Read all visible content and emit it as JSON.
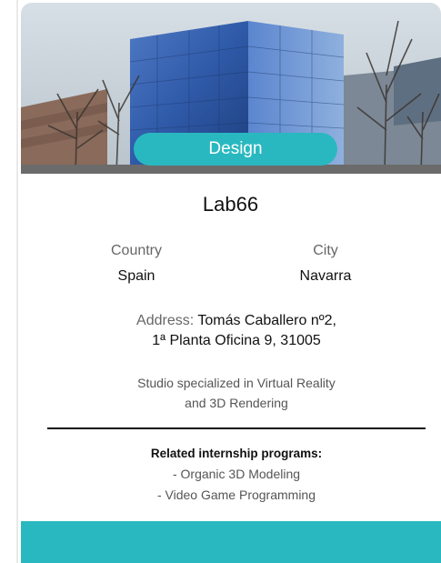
{
  "card": {
    "category": "Design",
    "title": "Lab66",
    "country_label": "Country",
    "country_value": "Spain",
    "city_label": "City",
    "city_value": "Navarra",
    "address_label": "Address:",
    "address_line1": "Tomás Caballero nº2,",
    "address_line2": "1ª Planta Oficina 9, 31005",
    "description_line1": "Studio specialized in Virtual Reality",
    "description_line2": "and 3D Rendering",
    "programs_heading": "Related internship programs:",
    "programs": [
      "- Organic 3D Modeling",
      "- Video Game Programming"
    ]
  },
  "colors": {
    "accent": "#29b8c0",
    "text": "#111111",
    "muted": "#666666"
  }
}
